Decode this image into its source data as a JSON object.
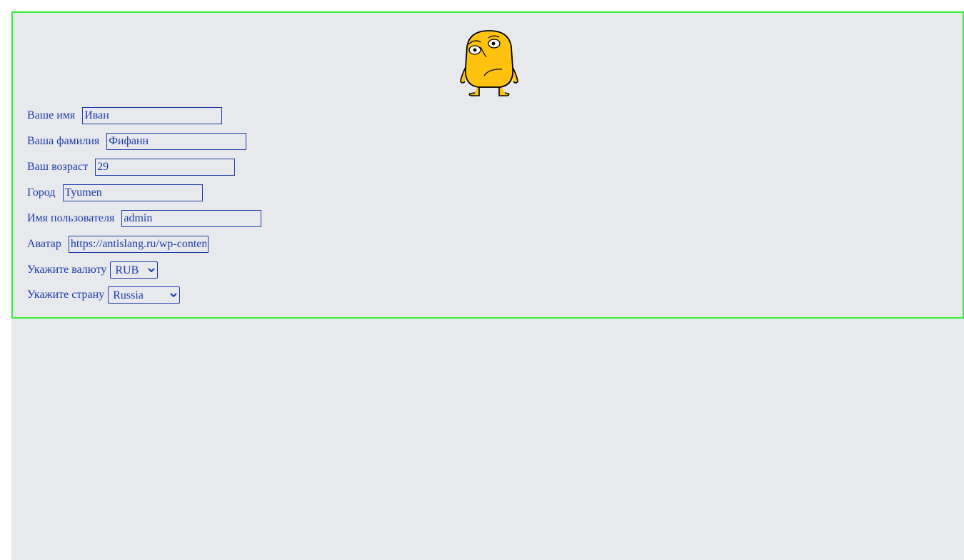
{
  "form": {
    "first_name": {
      "label": "Ваше имя",
      "value": "Иван"
    },
    "last_name": {
      "label": "Ваша фамилия",
      "value": "Фифанн"
    },
    "age": {
      "label": "Ваш возраст",
      "value": "29"
    },
    "city": {
      "label": "Город",
      "value": "Tyumen"
    },
    "username": {
      "label": "Имя пользователя",
      "value": "admin"
    },
    "avatar": {
      "label": "Аватар",
      "value": "https://antislang.ru/wp-content"
    },
    "currency": {
      "label": "Укажите валюту",
      "selected": "RUB"
    },
    "country": {
      "label": "Укажите страну",
      "selected": "Russia"
    }
  },
  "avatar_image": {
    "icon": "worried-yellow-character-icon"
  },
  "colors": {
    "accent": "#1a3cab",
    "border": "#33ee33",
    "background": "#e8e9ed",
    "avatar_fill": "#ffc20e"
  }
}
